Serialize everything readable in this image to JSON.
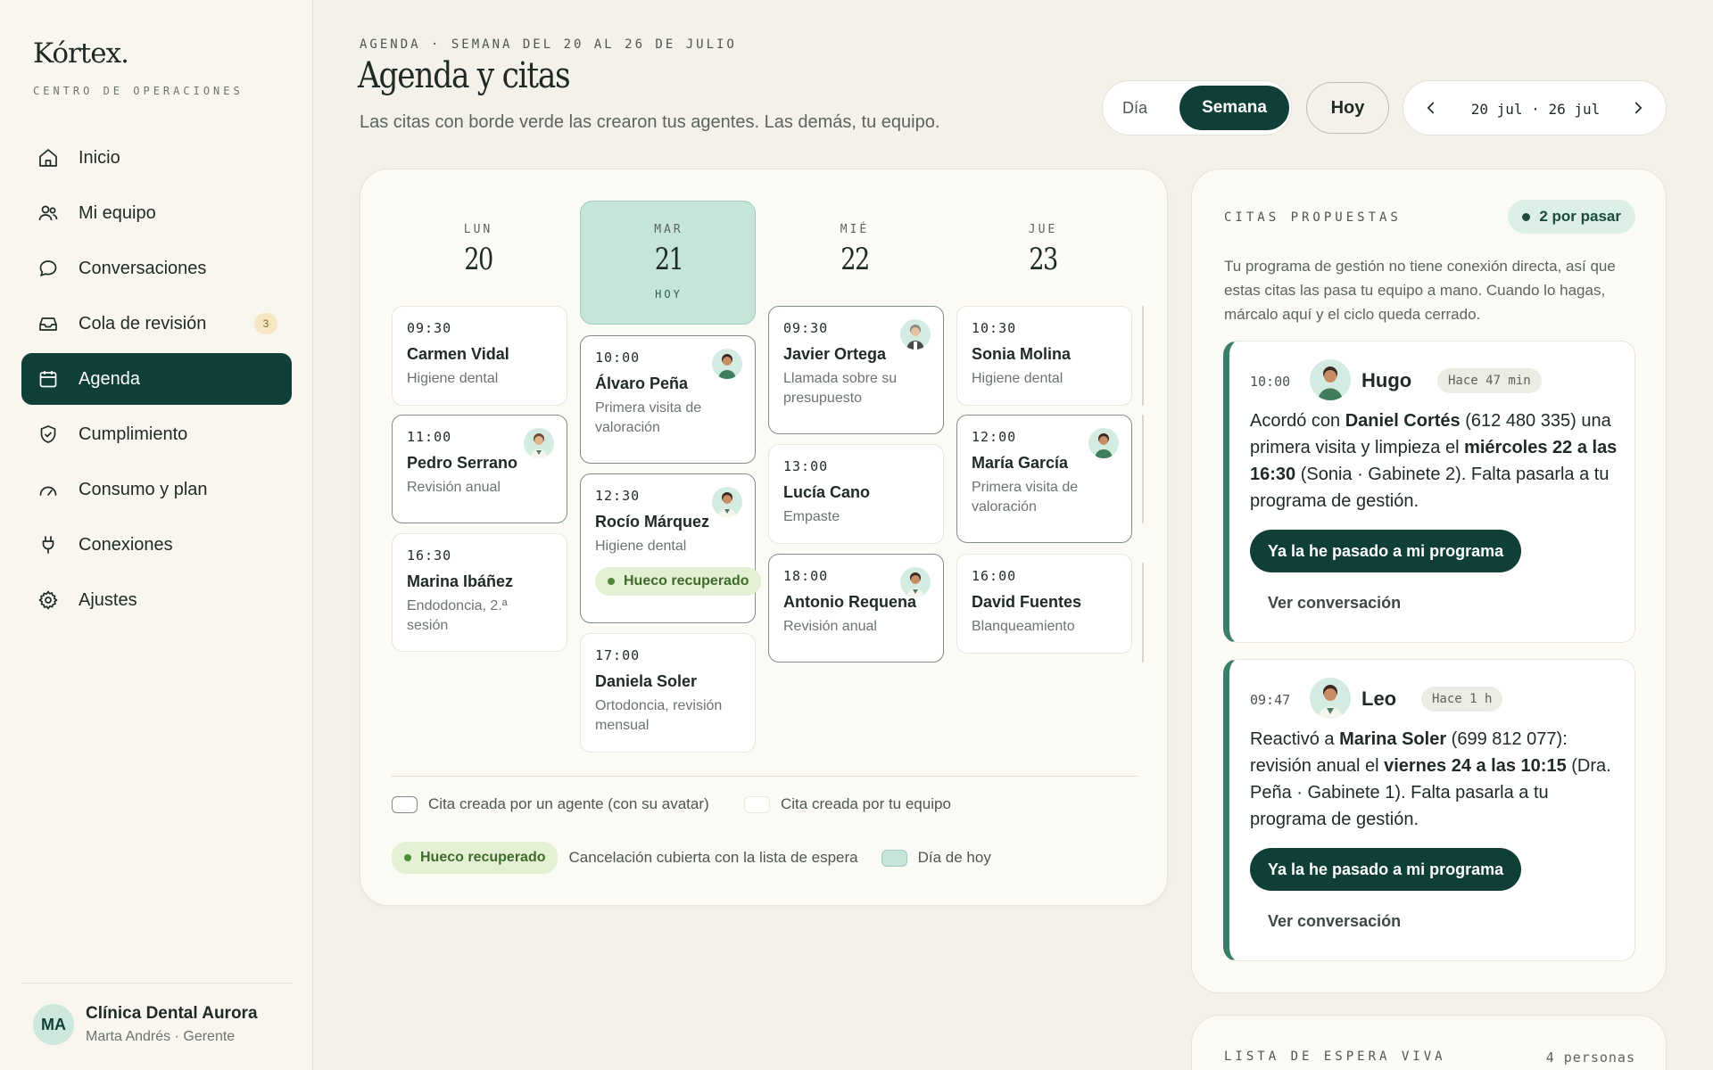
{
  "brand": {
    "name": "Kórtex.",
    "subtitle": "CENTRO DE OPERACIONES"
  },
  "sidebar": {
    "items": [
      {
        "label": "Inicio",
        "icon": "home-icon"
      },
      {
        "label": "Mi equipo",
        "icon": "users-icon"
      },
      {
        "label": "Conversaciones",
        "icon": "chat-bubble-icon"
      },
      {
        "label": "Cola de revisión",
        "icon": "inbox-icon",
        "badge": "3"
      },
      {
        "label": "Agenda",
        "icon": "calendar-icon",
        "active": true
      },
      {
        "label": "Cumplimiento",
        "icon": "shield-check-icon"
      },
      {
        "label": "Consumo y plan",
        "icon": "gauge-icon"
      },
      {
        "label": "Conexiones",
        "icon": "plug-icon"
      },
      {
        "label": "Ajustes",
        "icon": "gear-icon"
      }
    ],
    "user": {
      "initials": "MA",
      "org": "Clínica Dental Aurora",
      "role": "Marta Andrés · Gerente"
    }
  },
  "header": {
    "eyebrow": "AGENDA · SEMANA DEL 20 AL 26 DE JULIO",
    "title": "Agenda y citas",
    "subtitle": "Las citas con borde verde las crearon tus agentes. Las demás, tu equipo.",
    "view_day": "Día",
    "view_week": "Semana",
    "today_button": "Hoy",
    "range": "20 jul · 26 jul"
  },
  "calendar": {
    "today_label": "HOY",
    "days": [
      {
        "dow": "LUN",
        "num": "20"
      },
      {
        "dow": "MAR",
        "num": "21"
      },
      {
        "dow": "MIÉ",
        "num": "22"
      },
      {
        "dow": "JUE",
        "num": "23"
      }
    ],
    "appointments": [
      {
        "time": "09:30",
        "name": "Carmen Vidal",
        "type": "Higiene dental"
      },
      {
        "time": "11:00",
        "name": "Pedro Serrano",
        "type": "Revisión anual"
      },
      {
        "time": "16:30",
        "name": "Marina Ibáñez",
        "type": "Endodoncia, 2.ª sesión"
      },
      {
        "time": "10:00",
        "name": "Álvaro Peña",
        "type": "Primera visita de valoración"
      },
      {
        "time": "12:30",
        "name": "Rocío Márquez",
        "type": "Higiene dental",
        "tag": "Hueco recuperado"
      },
      {
        "time": "17:00",
        "name": "Daniela Soler",
        "type": "Ortodoncia, revisión mensual"
      },
      {
        "time": "09:30",
        "name": "Javier Ortega",
        "type": "Llamada sobre su presupuesto"
      },
      {
        "time": "13:00",
        "name": "Lucía Cano",
        "type": "Empaste"
      },
      {
        "time": "18:00",
        "name": "Antonio Requena",
        "type": "Revisión anual"
      },
      {
        "time": "10:30",
        "name": "Sonia Molina",
        "type": "Higiene dental"
      },
      {
        "time": "12:00",
        "name": "María García",
        "type": "Primera visita de valoración"
      },
      {
        "time": "16:00",
        "name": "David Fuentes",
        "type": "Blanqueamiento"
      }
    ],
    "legend": {
      "agent": "Cita creada por un agente (con su avatar)",
      "team": "Cita creada por tu equipo",
      "recovered_tag": "Hueco recuperado",
      "recovered_desc": "Cancelación cubierta con la lista de espera",
      "today": "Día de hoy"
    }
  },
  "proposed": {
    "eyebrow": "CITAS PROPUESTAS",
    "badge": "2 por pasar",
    "description": "Tu programa de gestión no tiene conexión directa, así que estas citas las pasa tu equipo a mano. Cuando lo hagas, márcalo aquí y el ciclo queda cerrado.",
    "items": [
      {
        "time": "10:00",
        "agent": "Hugo",
        "ago": "Hace 47 min",
        "t1": "Acordó con ",
        "b1": "Daniel Cortés",
        "t2": " (612 480 335) una primera visita y limpieza el ",
        "b2": "miércoles 22 a las 16:30",
        "t3": " (Sonia · Gabinete 2). Falta pasarla a tu programa de gestión.",
        "button": "Ya la he pasado a mi programa",
        "link": "Ver conversación"
      },
      {
        "time": "09:47",
        "agent": "Leo",
        "ago": "Hace 1 h",
        "t1": "Reactivó a ",
        "b1": "Marina Soler",
        "t2": " (699 812 077): revisión anual el ",
        "b2": "viernes 24 a las 10:15",
        "t3": " (Dra. Peña · Gabinete 1). Falta pasarla a tu programa de gestión.",
        "button": "Ya la he pasado a mi programa",
        "link": "Ver conversación"
      }
    ]
  },
  "waitlist": {
    "title": "LISTA DE ESPERA VIVA",
    "count": "4 personas"
  }
}
